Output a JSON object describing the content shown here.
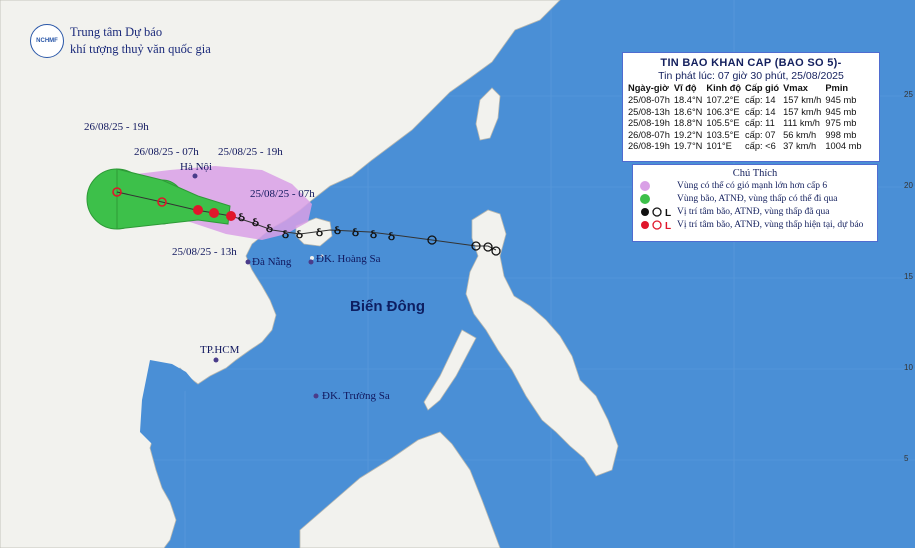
{
  "organization": {
    "line1": "Trung tâm Dự báo",
    "line2": "khí tượng thuỷ văn quốc gia",
    "logo_text": "NCHMF"
  },
  "bulletin": {
    "title": "TIN BAO KHAN CAP (BAO SO 5)-",
    "issued": "Tin phát lúc: 07 giờ 30 phút, 25/08/2025",
    "columns": [
      "Ngày-giờ",
      "Vĩ độ",
      "Kinh độ",
      "Cấp gió",
      "Vmax",
      "Pmin"
    ],
    "rows": [
      [
        "25/08-07h",
        "18.4°N",
        "107.2°E",
        "cấp: 14",
        "157 km/h",
        "945 mb"
      ],
      [
        "25/08-13h",
        "18.6°N",
        "106.3°E",
        "cấp: 14",
        "157 km/h",
        "945 mb"
      ],
      [
        "25/08-19h",
        "18.8°N",
        "105.5°E",
        "cấp: 11",
        "111 km/h",
        "975 mb"
      ],
      [
        "26/08-07h",
        "19.2°N",
        "103.5°E",
        "cấp: 07",
        "56 km/h",
        "998 mb"
      ],
      [
        "26/08-19h",
        "19.7°N",
        "101°E",
        "cấp: <6",
        "37 km/h",
        "1004 mb"
      ]
    ]
  },
  "legend": {
    "title": "Chú Thích",
    "items": [
      {
        "text": "Vùng có thể có gió mạnh lớn hơn cấp 6",
        "color": "#d9a0e6"
      },
      {
        "text": "Vùng bão, ATNĐ, vùng thấp có thể đi qua",
        "color": "#3dc04a"
      },
      {
        "text": "Vị trí tâm bão, ATNĐ, vùng thấp đã qua",
        "color": "#111111"
      },
      {
        "text": "Vị trí tâm bão, ATNĐ, vùng thấp hiện tại, dự báo",
        "color": "#e0162b"
      }
    ]
  },
  "map_labels": {
    "t1": "26/08/25 - 19h",
    "t2": "26/08/25 - 07h",
    "t3": "25/08/25 - 19h",
    "t4": "25/08/25 - 07h",
    "t5": "25/08/25 - 13h",
    "hanoi": "Hà Nội",
    "danang": "Đà Nẵng",
    "hoangsa": "ĐK. Hoàng Sa",
    "truongsa": "ĐK. Trường Sa",
    "hcm": "TP.HCM",
    "sea": "Biển Đông"
  },
  "axis": {
    "lat_right": [
      "25",
      "20",
      "15",
      "10",
      "5"
    ]
  },
  "colors": {
    "sea": "#4a8fd6",
    "land": "#f2f2ee",
    "wind_zone": "#d9a0e6",
    "cone": "#3dc04a",
    "storm_current": "#e0162b"
  }
}
